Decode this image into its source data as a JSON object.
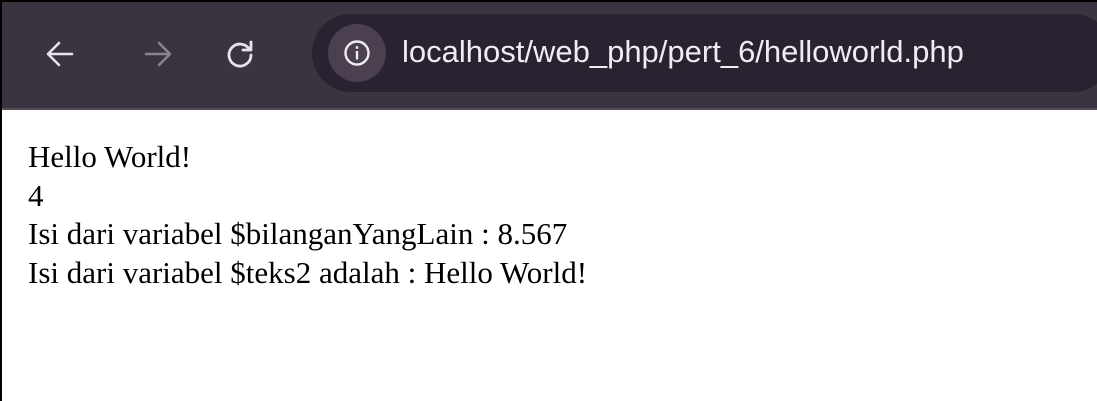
{
  "browser": {
    "toolbar": {
      "back_icon": "arrow-left-icon",
      "forward_icon": "arrow-right-icon",
      "reload_icon": "reload-icon",
      "site_info_icon": "info-circle-icon"
    },
    "address_bar": {
      "url": "localhost/web_php/pert_6/helloworld.php"
    },
    "colors": {
      "toolbar_bg": "#3c3341",
      "omnibox_bg": "#2a2230",
      "icon_active": "#e8e3ea",
      "icon_disabled": "#8a8290"
    }
  },
  "page": {
    "lines": [
      "Hello World!",
      "4",
      "Isi dari variabel $bilanganYangLain : 8.567",
      "Isi dari variabel $teks2 adalah : Hello World!"
    ]
  }
}
